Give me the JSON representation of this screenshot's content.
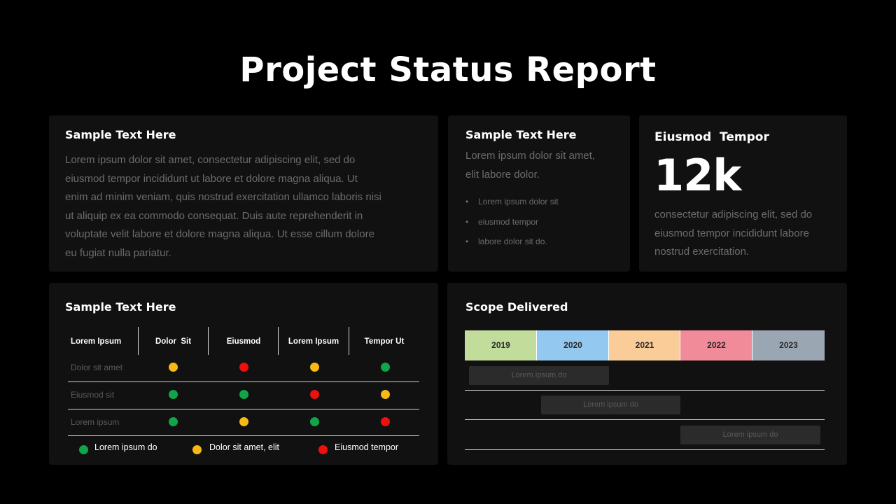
{
  "title": "Project Status Report",
  "card1": {
    "heading": "Sample Text Here",
    "lines": [
      "Lorem ipsum dolor sit amet, consectetur adipiscing elit, sed do",
      "eiusmod tempor incididunt ut labore et dolore magna aliqua. Ut",
      "enim ad minim veniam, quis nostrud exercitation ullamco laboris nisi",
      "ut aliquip ex ea commodo consequat. Duis aute reprehenderit in",
      "voluptate velit labore et dolore magna aliqua. Ut esse cillum dolore",
      "eu fugiat nulla pariatur."
    ]
  },
  "card2": {
    "heading": "Sample Text Here",
    "lines": [
      "Lorem ipsum dolor sit amet,",
      "elit labore dolor."
    ],
    "bullets": [
      "Lorem ipsum dolor sit",
      "eiusmod tempor",
      "labore dolor sit do."
    ]
  },
  "card3": {
    "heading": "Eiusmod  Tempor",
    "value": "12k",
    "lines": [
      "consectetur adipiscing elit, sed do",
      "eiusmod tempor incididunt labore",
      "nostrud exercitation."
    ]
  },
  "status_table": {
    "heading": "Sample Text Here",
    "columns": [
      "Lorem Ipsum",
      "Dolor  Sit",
      "Eiusmod",
      "Lorem Ipsum",
      "Tempor Ut"
    ],
    "rows": [
      {
        "label": "Dolor sit amet",
        "status": [
          "yellow",
          "red",
          "yellow",
          "green"
        ]
      },
      {
        "label": "Eiusmod sit",
        "status": [
          "green",
          "green",
          "red",
          "yellow"
        ]
      },
      {
        "label": "Lorem ipsum",
        "status": [
          "green",
          "yellow",
          "green",
          "red"
        ]
      }
    ],
    "legend": [
      {
        "color": "green",
        "label": "Lorem ipsum do"
      },
      {
        "color": "yellow",
        "label": "Dolor sit amet, elit"
      },
      {
        "color": "red",
        "label": "Eiusmod tempor"
      }
    ],
    "status_colors": {
      "green": "#0fa548",
      "yellow": "#f8b914",
      "red": "#ee0f0f"
    }
  },
  "scope": {
    "heading": "Scope Delivered",
    "years": [
      {
        "label": "2019",
        "color": "#c1dc9b"
      },
      {
        "label": "2020",
        "color": "#93c9f1"
      },
      {
        "label": "2021",
        "color": "#f9cc98"
      },
      {
        "label": "2022",
        "color": "#f18a99"
      },
      {
        "label": "2023",
        "color": "#9aa7b3"
      }
    ],
    "tasks": [
      {
        "label": "Lorem ipsum do",
        "start_year": "2019",
        "end_year": "2020"
      },
      {
        "label": "Lorem ipsum do",
        "start_year": "2020",
        "end_year": "2021"
      },
      {
        "label": "Lorem ipsum do",
        "start_year": "2022",
        "end_year": "2023"
      }
    ]
  }
}
